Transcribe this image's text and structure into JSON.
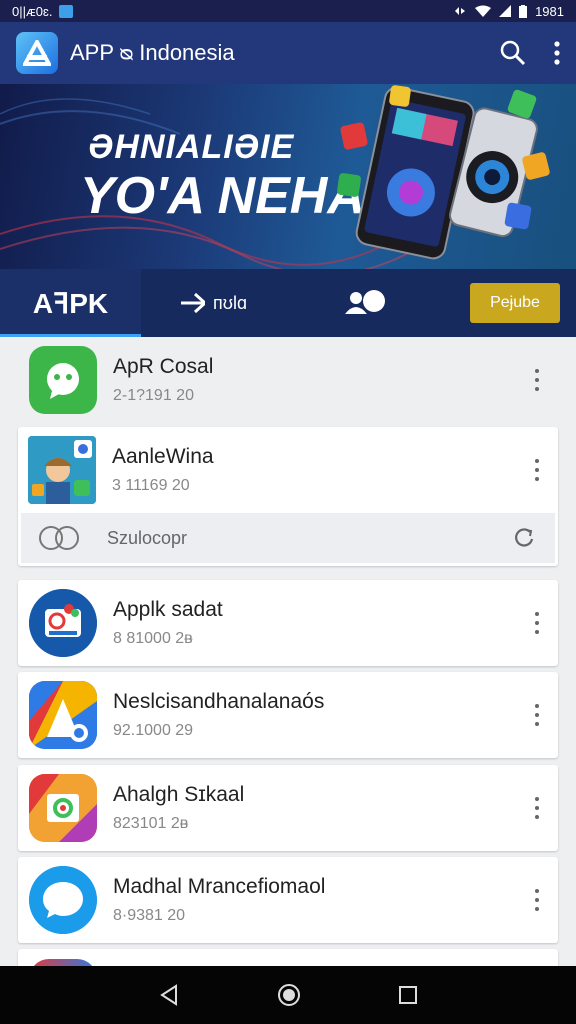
{
  "status_bar": {
    "time_left": "0||ᴁ0ɛ.",
    "time_right": "1981"
  },
  "header": {
    "title": "APP ᴓ Indonesia"
  },
  "banner": {
    "subtitle": "ƏHNIALIƏIE",
    "headline": "YO'A NEHA"
  },
  "tabs": {
    "apk_label": "AꟻPK",
    "news_label": "ᴨʊlɑ",
    "premium_label": "Peɉube"
  },
  "apps": [
    {
      "name": "ApR Cosal",
      "meta": "2‑1?191 20"
    },
    {
      "name": "AanleWina",
      "meta": "3 11169 20"
    },
    {
      "name": "Applk sadat",
      "meta": "8 81000 2ᴃ"
    },
    {
      "name": "Neslcisandhanalanaós",
      "meta": "92.1000 29"
    },
    {
      "name": "Ahalgh Sɪkaal",
      "meta": "823101 2ᴃ"
    },
    {
      "name": "Madhal Mrancefiomaol",
      "meta": "8·9381 20"
    }
  ],
  "inline_search": {
    "label": "Szulocopr"
  },
  "colors": {
    "app_bar": "#23387a",
    "tab_bar": "#162a5e",
    "accent": "#3aa2f0",
    "premium": "#c9a71f",
    "nav_bar": "#050505"
  }
}
